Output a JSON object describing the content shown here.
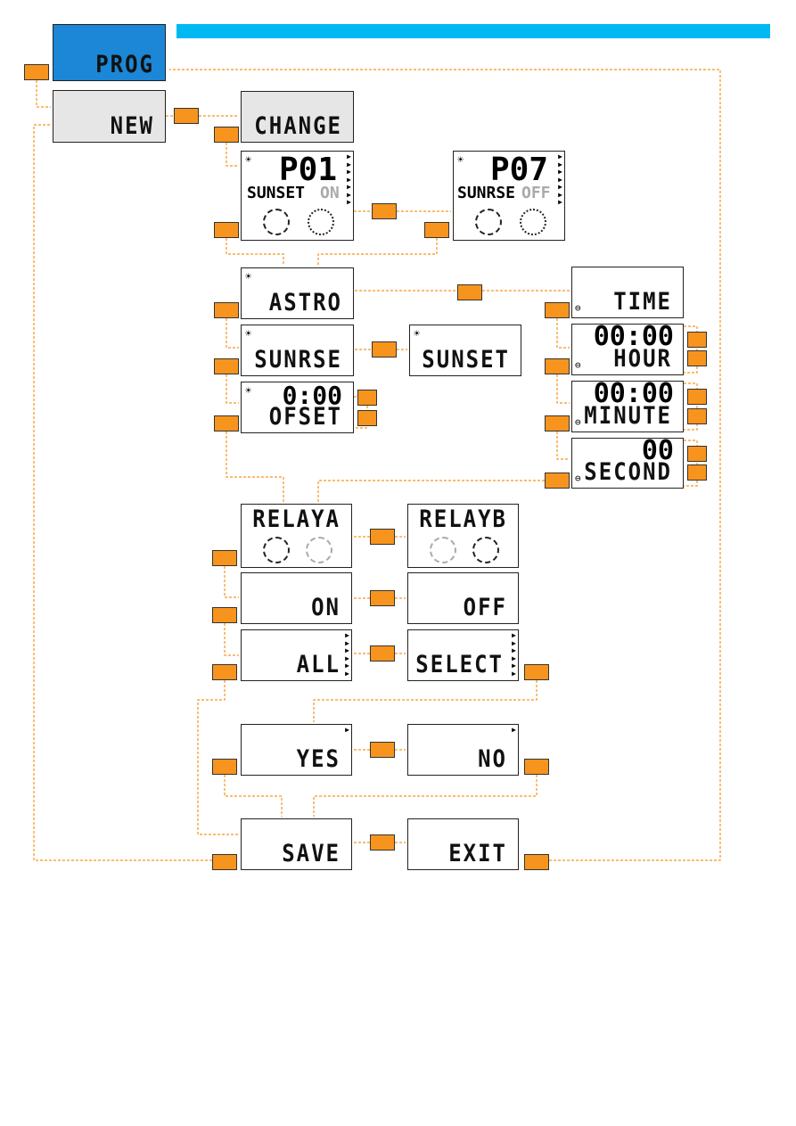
{
  "screens": {
    "prog": "PROG",
    "new": "NEW",
    "change": "CHANGE",
    "p01": {
      "num": "P01",
      "label": "SUNSET",
      "state": "ON"
    },
    "p07": {
      "num": "P07",
      "label": "SUNRSE",
      "state": "OFF"
    },
    "astro": "ASTRO",
    "time": "TIME",
    "sunrise": "SUNRSE",
    "sunset": "SUNSET",
    "offset": {
      "value": "0:00",
      "label": "OFSET"
    },
    "hour": {
      "value": "00:00",
      "label": "HOUR"
    },
    "minute": {
      "value": "00:00",
      "label": "MINUTE"
    },
    "second": {
      "value": "00",
      "label": "SECOND"
    },
    "relaya": "RELAYA",
    "relayb": "RELAYB",
    "on": "ON",
    "off": "OFF",
    "all": "ALL",
    "select": "SELECT",
    "yes": "YES",
    "no": "NO",
    "save": "SAVE",
    "exit": "EXIT"
  },
  "colors": {
    "accent": "#f7941d",
    "bar": "#00b9f2",
    "prog": "#1b87d6"
  },
  "icons": {
    "sun": "sun-icon",
    "clock": "clock-icon",
    "arrows": "channel-arrows-icon",
    "relay": "relay-dial-icon"
  }
}
